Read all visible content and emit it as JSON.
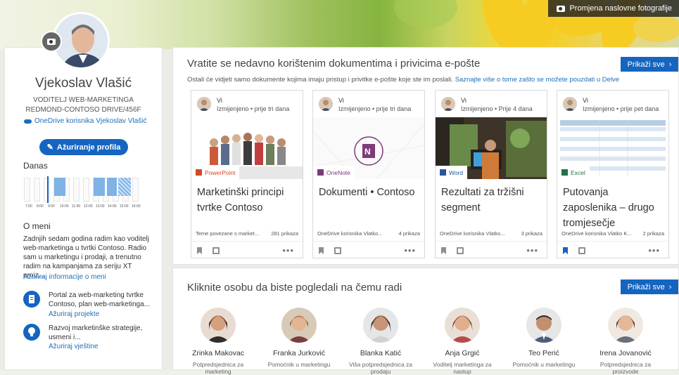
{
  "banner": {
    "change_cover": "Promjena naslovne fotografije"
  },
  "profile": {
    "name": "Vjekoslav Vlašić",
    "title_line1": "VODITELJ WEB-MARKETINGA",
    "title_line2": "REDMOND-CONTOSO DRIVE/456F",
    "onedrive_link": "OneDrive korisnika Vjekoslav Vlašić",
    "update_button": "Ažuriranje profila",
    "today_heading": "Danas",
    "calendar_ticks": [
      "7:00",
      "8:00",
      "9:00",
      "10:00",
      "11:00",
      "12:00",
      "13:00",
      "14:00",
      "15:00",
      "16:00"
    ],
    "about_heading": "O meni",
    "about_text": "Zadnjih sedam godina radim kao voditelj web-marketinga u tvrtki Contoso. Radio sam u marketingu i prodaji, a trenutno radim na kampanjama za seriju XT proiz...",
    "about_link": "Ažuriraj informacije o meni",
    "projects_text": "Portal za web-marketing tvrtke Contoso, plan web-marketinga...",
    "projects_link": "Ažuriraj projekte",
    "skills_text": "Razvoj marketinške strategije, usmeni i...",
    "skills_link": "Ažuriraj vještine"
  },
  "documents": {
    "heading": "Vratite se nedavno korištenim dokumentima i privicima e-pošte",
    "subtitle": "Ostali će vidjeti samo dokumente kojima imaju pristup i privitke e-pošte koje ste im poslali.",
    "subtitle_link": "Saznajte više o tome zašto se možete pouzdati u Delve",
    "show_all": "Prikaži sve",
    "cards": [
      {
        "author": "Vi",
        "modified": "Izmijenjeno • prije tri dana",
        "app": "PowerPoint",
        "app_color": "#d24726",
        "title": "Marketinški principi tvrtke Contoso",
        "source": "Teme povezane s market...",
        "views": "281 prikaza",
        "bookmarked": false
      },
      {
        "author": "Vi",
        "modified": "Izmijenjeno • prije tri dana",
        "app": "OneNote",
        "app_color": "#80397b",
        "title": "Dokumenti • Contoso",
        "source": "OneDrive korisnika Vlatko...",
        "views": "4 prikaza",
        "bookmarked": false
      },
      {
        "author": "Vi",
        "modified": "Izmijenjeno • Prije 4 dana",
        "app": "Word",
        "app_color": "#2b579a",
        "title": "Rezultati za tržišni segment",
        "source": "OneDrive korisnika Vlatko...",
        "views": "3 prikaza",
        "bookmarked": false
      },
      {
        "author": "Vi",
        "modified": "Izmijenjeno • prije pet dana",
        "app": "Excel",
        "app_color": "#217346",
        "title": "Putovanja zaposlenika – drugo tromjesečje",
        "source": "OneDrive korisnika Vlatko K...",
        "views": "2 prikaza",
        "bookmarked": true
      }
    ]
  },
  "people": {
    "heading": "Kliknite osobu da biste pogledali na čemu radi",
    "show_all": "Prikaži sve",
    "list": [
      {
        "name": "Zrinka Makovac",
        "role": "Potpredsjednica za marketing"
      },
      {
        "name": "Franka Jurković",
        "role": "Pomoćnik u marketingu"
      },
      {
        "name": "Blanka Katić",
        "role": "Viša potpredsjednica za prodaju"
      },
      {
        "name": "Anja Grgić",
        "role": "Voditelj marketinga za nastup"
      },
      {
        "name": "Teo Perić",
        "role": "Pomoćnik u marketingu"
      },
      {
        "name": "Irena Jovanović",
        "role": "Potpredsjednica za proizvode"
      }
    ]
  },
  "colors": {
    "accent": "#1565c0",
    "link": "#1f6fb6"
  }
}
